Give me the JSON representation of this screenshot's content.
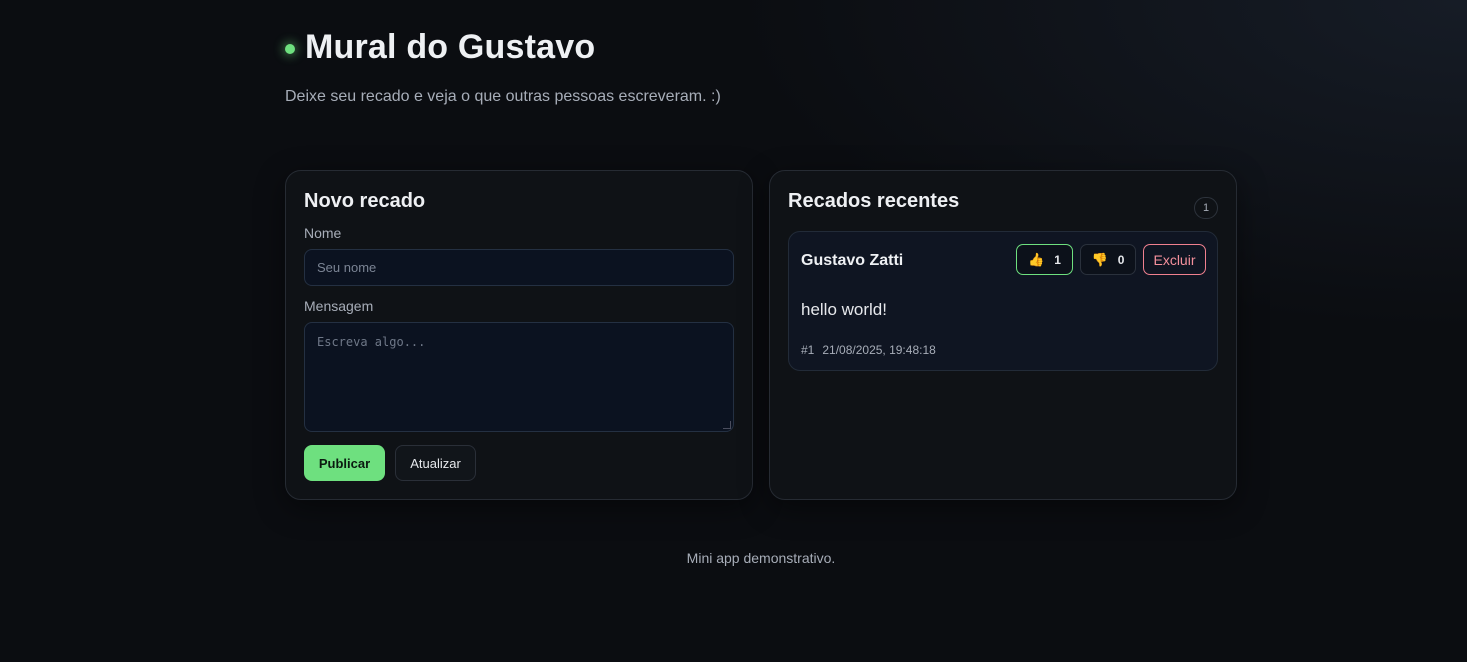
{
  "header": {
    "title": "Mural do Gustavo",
    "subtitle": "Deixe seu recado e veja o que outras pessoas escreveram. :)",
    "status_color": "#6ee07f"
  },
  "form": {
    "title": "Novo recado",
    "name_label": "Nome",
    "name_placeholder": "Seu nome",
    "name_value": "",
    "message_label": "Mensagem",
    "message_placeholder": "Escreva algo...",
    "message_value": "",
    "publish_label": "Publicar",
    "refresh_label": "Atualizar"
  },
  "recent": {
    "title": "Recados recentes",
    "count": "1",
    "messages": [
      {
        "author": "Gustavo Zatti",
        "likes": "1",
        "dislikes": "0",
        "like_icon": "thumbs-up-icon",
        "dislike_icon": "thumbs-down-icon",
        "delete_label": "Excluir",
        "text": "hello world!",
        "id": "#1",
        "timestamp": "21/08/2025, 19:48:18"
      }
    ]
  },
  "footer": {
    "text": "Mini app demonstrativo."
  },
  "colors": {
    "accent": "#6ee07f",
    "danger": "#f0808f",
    "background": "#0b0d11"
  }
}
